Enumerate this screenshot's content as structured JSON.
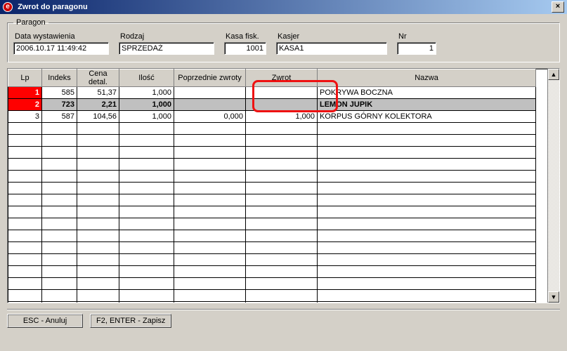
{
  "window": {
    "title": "Zwrot do paragonu"
  },
  "paragon": {
    "legend": "Paragon",
    "fields": {
      "data_label": "Data wystawienia",
      "data_value": "2006.10.17 11:49:42",
      "rodzaj_label": "Rodzaj",
      "rodzaj_value": "SPRZEDAŻ",
      "kasa_label": "Kasa fisk.",
      "kasa_value": "1001",
      "kasjer_label": "Kasjer",
      "kasjer_value": "KASA1",
      "nr_label": "Nr",
      "nr_value": "1"
    }
  },
  "grid": {
    "headers": {
      "lp": "Lp",
      "indeks": "Indeks",
      "cena": "Cena detal.",
      "ilosc": "Ilość",
      "poprz": "Poprzednie zwroty",
      "zwrot": "Zwrot",
      "nazwa": "Nazwa"
    },
    "rows": [
      {
        "lp": "1",
        "indeks": "585",
        "cena": "51,37",
        "ilosc": "1,000",
        "poprz": "",
        "zwrot": "",
        "nazwa": "POKRYWA BOCZNA",
        "selected": false,
        "lp_red": true
      },
      {
        "lp": "2",
        "indeks": "723",
        "cena": "2,21",
        "ilosc": "1,000",
        "poprz": "",
        "zwrot": "",
        "nazwa": "LEMON JUPIK",
        "selected": true,
        "lp_red": true
      },
      {
        "lp": "3",
        "indeks": "587",
        "cena": "104,56",
        "ilosc": "1,000",
        "poprz": "0,000",
        "zwrot": "1,000",
        "nazwa": "KORPUS GÓRNY KOLEKTORA",
        "selected": false,
        "lp_red": false
      }
    ],
    "empty_rows": 16
  },
  "buttons": {
    "cancel": "ESC - Anuluj",
    "save": "F2, ENTER - Zapisz"
  }
}
